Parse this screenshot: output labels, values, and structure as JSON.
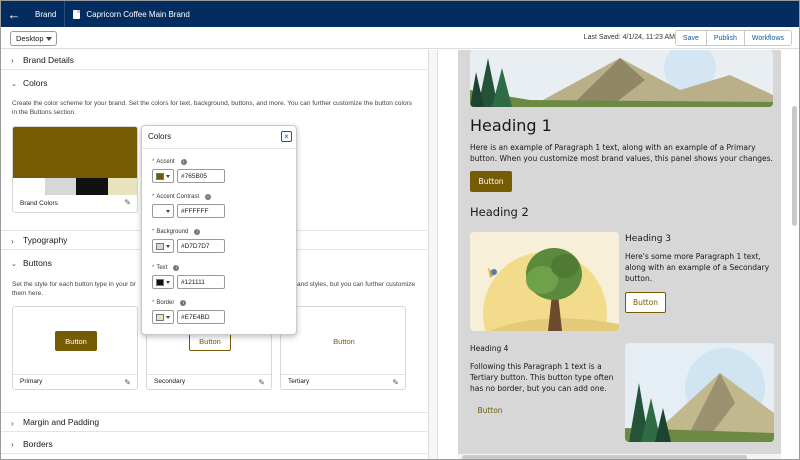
{
  "topbar": {
    "brand_label": "Brand",
    "brand_name": "Capricorn Coffee Main Brand"
  },
  "toolbar": {
    "device": "Desktop",
    "last_saved": "Last Saved: 4/1/24, 11:23 AM",
    "save_label": "Save",
    "publish_label": "Publish",
    "workflows_label": "Workflows"
  },
  "sections": {
    "brand_details": "Brand Details",
    "colors": "Colors",
    "colors_desc": "Create the color scheme for your brand. Set the colors for text, background, buttons, and more. You can further customize the button colors in the Buttons section.",
    "brand_colors_label": "Brand Colors",
    "typography": "Typography",
    "buttons": "Buttons",
    "buttons_desc_left": "Set the style for each button type in your br",
    "buttons_desc_right": "and styles, but you can further customize",
    "buttons_desc_line2": "them here.",
    "margin_padding": "Margin and Padding",
    "borders": "Borders"
  },
  "brand_swatches": {
    "main": "#765B05",
    "row": [
      "#FFFFFF",
      "#D7D7D7",
      "#121111",
      "#E7E4BD"
    ]
  },
  "button_cards": {
    "primary": {
      "label": "Primary",
      "sample": "Button"
    },
    "secondary": {
      "label": "Secondary",
      "sample": "Button"
    },
    "tertiary": {
      "label": "Tertiary",
      "sample": "Button"
    }
  },
  "colors_popover": {
    "title": "Colors",
    "fields": [
      {
        "label": "Accent",
        "value": "#765B05",
        "color": "#765B05"
      },
      {
        "label": "Accent Contrast",
        "value": "#FFFFFF",
        "color": "#FFFFFF"
      },
      {
        "label": "Background",
        "value": "#D7D7D7",
        "color": "#D7D7D7"
      },
      {
        "label": "Text",
        "value": "#121111",
        "color": "#121111"
      },
      {
        "label": "Border",
        "value": "#E7E4BD",
        "color": "#E7E4BD"
      }
    ]
  },
  "preview": {
    "heading1": "Heading 1",
    "para1": "Here is an example of Paragraph 1 text, along with an example of a Primary button. When you customize most brand values, this panel shows your changes.",
    "primary_button": "Button",
    "heading2": "Heading 2",
    "heading3": "Heading 3",
    "para3": "Here's some more Paragraph 1 text, along with an example of a Secondary button.",
    "secondary_button": "Button",
    "heading4": "Heading 4",
    "para4": "Following this Paragraph 1 text is a Tertiary button. This button type often has no border, but you can add one.",
    "tertiary_button": "Button"
  },
  "icons": [
    "back-arrow-icon",
    "document-icon",
    "chevron-right-icon",
    "chevron-down-icon",
    "pencil-icon",
    "close-icon",
    "info-icon"
  ]
}
